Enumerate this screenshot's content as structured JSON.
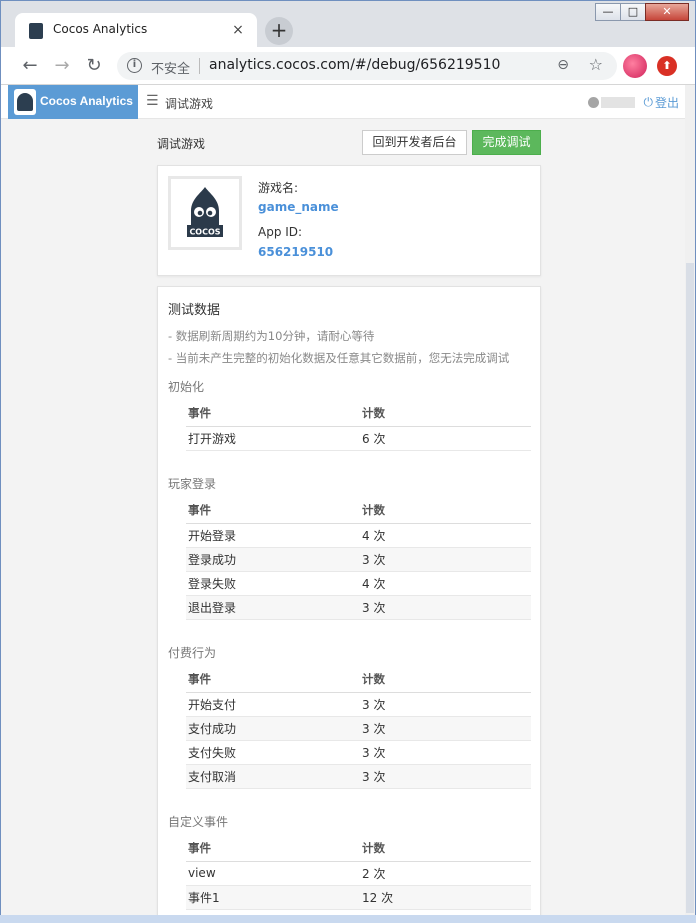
{
  "browser": {
    "tab_title": "Cocos Analytics",
    "tab_close": "×",
    "newtab": "+",
    "insecure_label": "不安全",
    "url": "analytics.cocos.com/#/debug/656219510",
    "back": "←",
    "forward": "→",
    "reload": "↻",
    "zoom": "⊖",
    "star": "☆",
    "ext": "⬆",
    "info": "i",
    "win_min": "—",
    "win_max": "□",
    "win_close": "✕"
  },
  "app": {
    "brand": "Cocos Analytics",
    "menu_icon": "☰",
    "breadcrumb": "调试游戏",
    "logout": "登出",
    "power_icon": "⏻"
  },
  "page": {
    "title": "调试游戏",
    "back_button": "回到开发者后台",
    "done_button": "完成调试"
  },
  "game": {
    "name_label": "游戏名:",
    "name_value": "game_name",
    "appid_label": "App ID:",
    "appid_value": "656219510",
    "icon_text": "COCOS"
  },
  "test": {
    "title": "测试数据",
    "note1": "- 数据刷新周期约为10分钟，请耐心等待",
    "note2": "- 当前未产生完整的初始化数据及任意其它数据前，您无法完成调试",
    "col_event": "事件",
    "col_count": "计数",
    "groups": [
      {
        "title": "初始化",
        "rows": [
          {
            "event": "打开游戏",
            "count": "6 次"
          }
        ]
      },
      {
        "title": "玩家登录",
        "rows": [
          {
            "event": "开始登录",
            "count": "4 次"
          },
          {
            "event": "登录成功",
            "count": "3 次"
          },
          {
            "event": "登录失败",
            "count": "4 次"
          },
          {
            "event": "退出登录",
            "count": "3 次"
          }
        ]
      },
      {
        "title": "付费行为",
        "rows": [
          {
            "event": "开始支付",
            "count": "3 次"
          },
          {
            "event": "支付成功",
            "count": "3 次"
          },
          {
            "event": "支付失败",
            "count": "3 次"
          },
          {
            "event": "支付取消",
            "count": "3 次"
          }
        ]
      },
      {
        "title": "自定义事件",
        "rows": [
          {
            "event": "view",
            "count": "2 次"
          },
          {
            "event": "事件1",
            "count": "12 次"
          }
        ]
      }
    ]
  },
  "colors": {
    "brand": "#5b9bd5",
    "done": "#5cb85c",
    "link": "#4a90d9"
  }
}
